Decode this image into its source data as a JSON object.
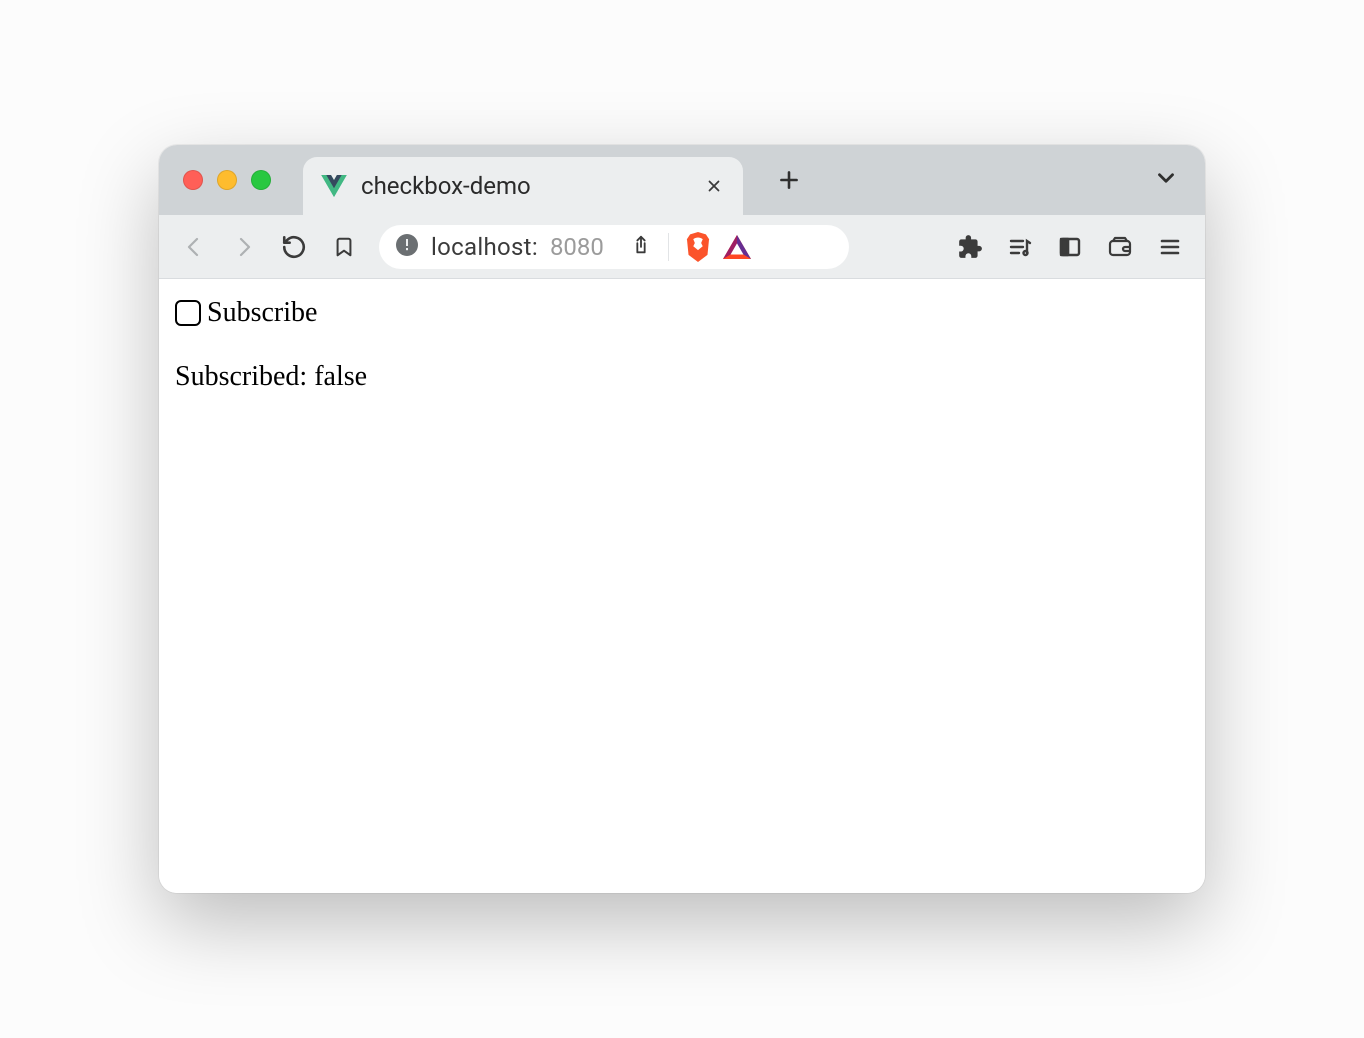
{
  "tab": {
    "title": "checkbox-demo"
  },
  "address": {
    "host": "localhost:",
    "port": "8080"
  },
  "page": {
    "checkbox_label": "Subscribe",
    "checkbox_checked": false,
    "status_prefix": "Subscribed: ",
    "status_value": "false"
  }
}
